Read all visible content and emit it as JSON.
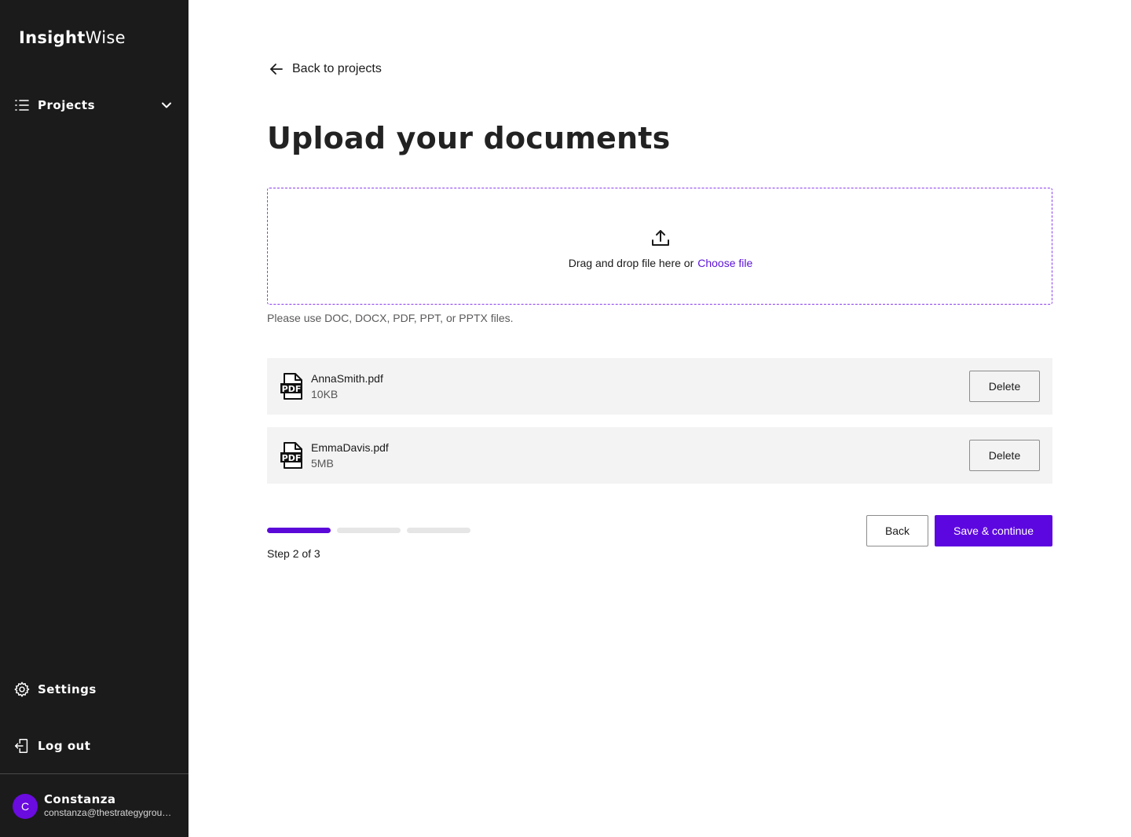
{
  "sidebar": {
    "brand_bold": "Insight",
    "brand_regular": "Wise",
    "nav": {
      "projects": {
        "label": "Projects",
        "icon": "list-icon"
      },
      "settings": {
        "label": "Settings",
        "icon": "gear-icon"
      },
      "logout": {
        "label": "Log out",
        "icon": "logout-icon"
      }
    },
    "user": {
      "initial": "C",
      "name": "Constanza",
      "email": "constanza@thestrategygroup.c..."
    }
  },
  "main": {
    "back_link": "Back to projects",
    "title": "Upload your documents",
    "dropzone": {
      "text": "Drag and drop file here or",
      "choose": "Choose file",
      "icon": "upload-icon"
    },
    "hint": "Please use DOC, DOCX, PDF, PPT, or PPTX files.",
    "files": [
      {
        "name": "AnnaSmith.pdf",
        "size": "10KB",
        "action": "Delete",
        "icon": "pdf-file-icon"
      },
      {
        "name": "EmmaDavis.pdf",
        "size": "5MB",
        "action": "Delete",
        "icon": "pdf-file-icon"
      }
    ],
    "progress": {
      "current": 2,
      "total": 3,
      "label": "Step 2 of 3"
    },
    "buttons": {
      "back": "Back",
      "save": "Save & continue"
    }
  },
  "colors": {
    "sidebar_bg": "#1b1b1b",
    "accent": "#5d07e0",
    "dropzone_border": "#8a3df0",
    "file_row_bg": "#f3f3f3"
  }
}
